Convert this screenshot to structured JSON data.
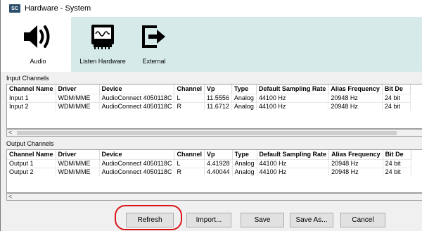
{
  "window": {
    "app_icon_text": "SC",
    "title": "Hardware - System"
  },
  "toolbar": {
    "items": [
      {
        "label": "Audio",
        "icon": "speaker-icon"
      },
      {
        "label": "Listen Hardware",
        "icon": "sound-card-icon"
      },
      {
        "label": "External",
        "icon": "external-arrow-icon"
      }
    ]
  },
  "input_channels": {
    "label": "Input Channels",
    "columns": [
      "Channel Name",
      "Driver",
      "Device",
      "Channel",
      "Vp",
      "Type",
      "Default Sampling Rate",
      "Alias Frequency",
      "Bit De"
    ],
    "rows": [
      [
        "Input 1",
        "WDM/MME",
        "AudioConnect 4050118C",
        "L",
        "11.5556",
        "Analog",
        "44100 Hz",
        "20948 Hz",
        "24 bit"
      ],
      [
        "Input 2",
        "WDM/MME",
        "AudioConnect 4050118C",
        "R",
        "11.6712",
        "Analog",
        "44100 Hz",
        "20948 Hz",
        "24 bit"
      ]
    ]
  },
  "output_channels": {
    "label": "Output Channels",
    "columns": [
      "Channel Name",
      "Driver",
      "Device",
      "Channel",
      "Vp",
      "Type",
      "Default Sampling Rate",
      "Alias Frequency",
      "Bit De"
    ],
    "rows": [
      [
        "Output 1",
        "WDM/MME",
        "AudioConnect 4050118C",
        "L",
        "4.41928",
        "Analog",
        "44100 Hz",
        "20948 Hz",
        "24 bit"
      ],
      [
        "Output 2",
        "WDM/MME",
        "AudioConnect 4050118C",
        "R",
        "4.40044",
        "Analog",
        "44100 Hz",
        "20948 Hz",
        "24 bit"
      ]
    ]
  },
  "scroll_arrow": "<",
  "buttons": {
    "refresh": "Refresh",
    "import": "Import...",
    "save": "Save",
    "save_as": "Save As...",
    "cancel": "Cancel"
  },
  "colors": {
    "toolbar_tab_bg": "#d6ebe9",
    "highlight": "#d9151b",
    "app_icon": "#2d4f6c"
  }
}
